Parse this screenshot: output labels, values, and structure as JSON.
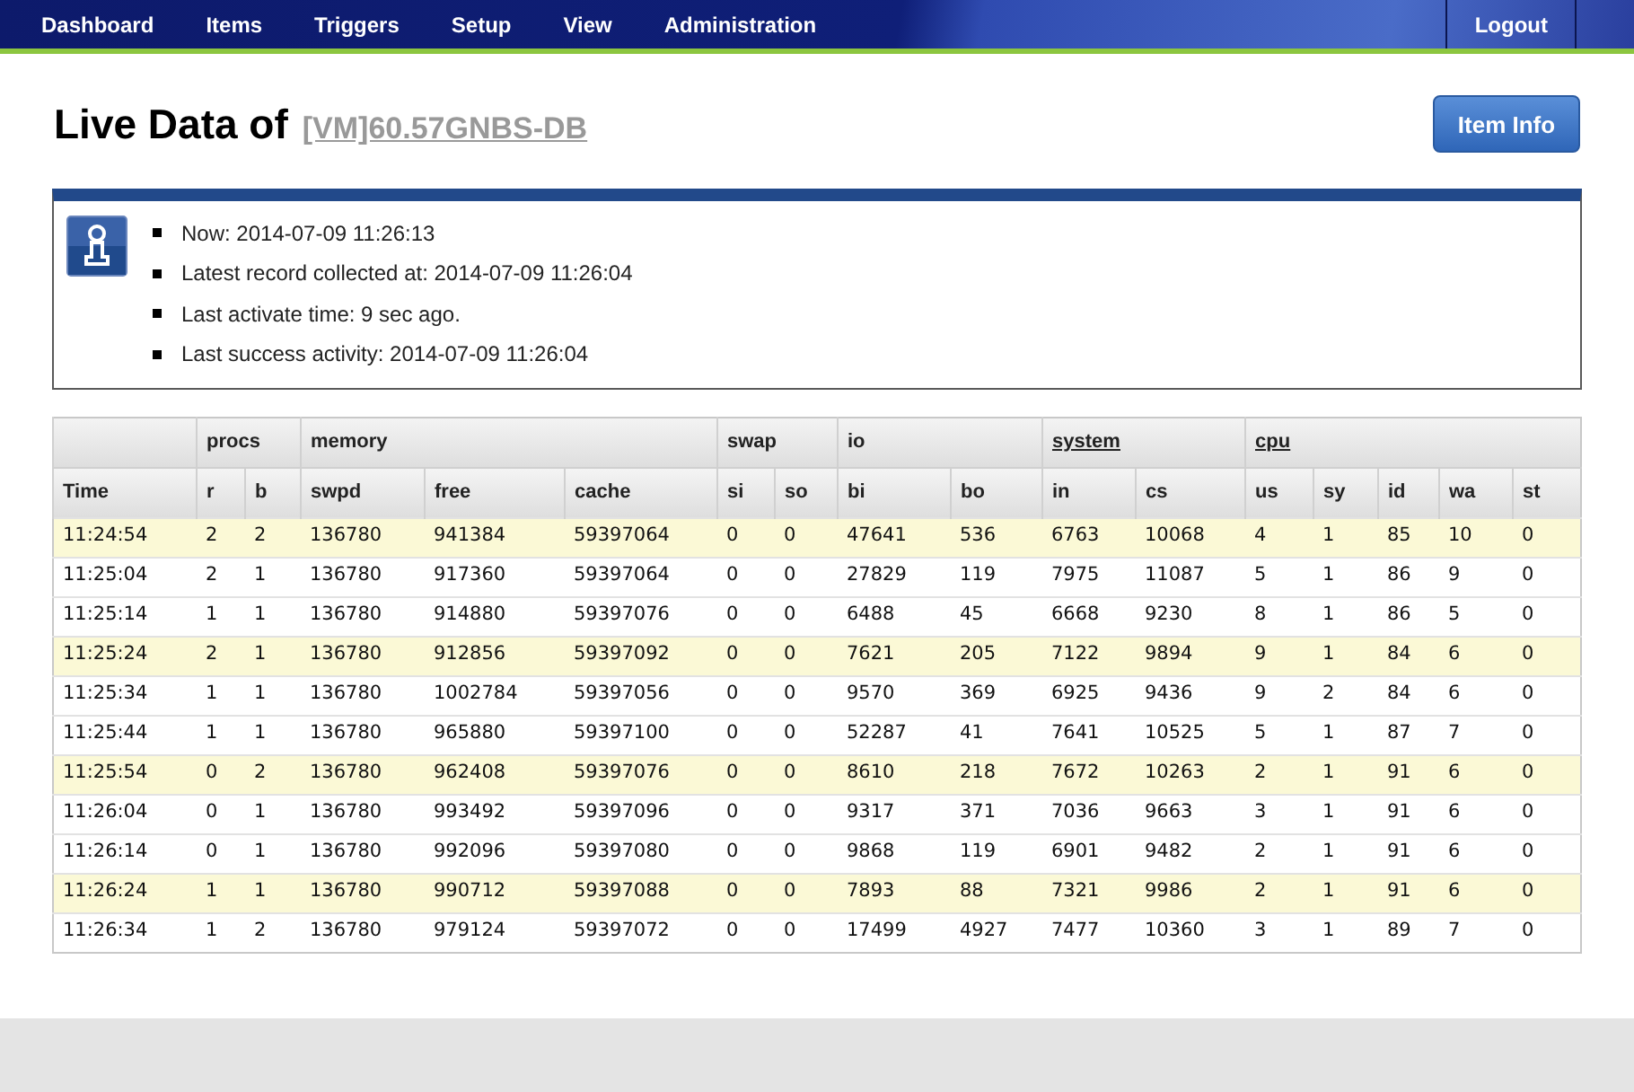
{
  "nav": {
    "items": [
      {
        "label": "Dashboard"
      },
      {
        "label": "Items"
      },
      {
        "label": "Triggers"
      },
      {
        "label": "Setup"
      },
      {
        "label": "View"
      },
      {
        "label": "Administration"
      }
    ],
    "logout": "Logout"
  },
  "header": {
    "title": "Live Data of",
    "host": "[VM]60.57GNBS-DB",
    "button": "Item Info"
  },
  "info": [
    "Now: 2014-07-09 11:26:13",
    "Latest record collected at: 2014-07-09 11:26:04",
    "Last activate time: 9 sec ago.",
    "Last success activity: 2014-07-09 11:26:04"
  ],
  "table": {
    "groups": [
      {
        "columns": [
          "Time"
        ]
      },
      {
        "label": "procs",
        "link": false,
        "columns": [
          "r",
          "b"
        ]
      },
      {
        "label": "memory",
        "link": false,
        "columns": [
          "swpd",
          "free",
          "cache"
        ]
      },
      {
        "label": "swap",
        "link": false,
        "columns": [
          "si",
          "so"
        ]
      },
      {
        "label": "io",
        "link": false,
        "columns": [
          "bi",
          "bo"
        ]
      },
      {
        "label": "system",
        "link": true,
        "columns": [
          "in",
          "cs"
        ]
      },
      {
        "label": "cpu",
        "link": true,
        "columns": [
          "us",
          "sy",
          "id",
          "wa",
          "st"
        ]
      }
    ],
    "rows": [
      {
        "highlighted": true,
        "cells": [
          "11:24:54",
          "2",
          "2",
          "136780",
          "941384",
          "59397064",
          "0",
          "0",
          "47641",
          "536",
          "6763",
          "10068",
          "4",
          "1",
          "85",
          "10",
          "0"
        ]
      },
      {
        "highlighted": false,
        "cells": [
          "11:25:04",
          "2",
          "1",
          "136780",
          "917360",
          "59397064",
          "0",
          "0",
          "27829",
          "119",
          "7975",
          "11087",
          "5",
          "1",
          "86",
          "9",
          "0"
        ]
      },
      {
        "highlighted": false,
        "cells": [
          "11:25:14",
          "1",
          "1",
          "136780",
          "914880",
          "59397076",
          "0",
          "0",
          "6488",
          "45",
          "6668",
          "9230",
          "8",
          "1",
          "86",
          "5",
          "0"
        ]
      },
      {
        "highlighted": true,
        "cells": [
          "11:25:24",
          "2",
          "1",
          "136780",
          "912856",
          "59397092",
          "0",
          "0",
          "7621",
          "205",
          "7122",
          "9894",
          "9",
          "1",
          "84",
          "6",
          "0"
        ]
      },
      {
        "highlighted": false,
        "cells": [
          "11:25:34",
          "1",
          "1",
          "136780",
          "1002784",
          "59397056",
          "0",
          "0",
          "9570",
          "369",
          "6925",
          "9436",
          "9",
          "2",
          "84",
          "6",
          "0"
        ]
      },
      {
        "highlighted": false,
        "cells": [
          "11:25:44",
          "1",
          "1",
          "136780",
          "965880",
          "59397100",
          "0",
          "0",
          "52287",
          "41",
          "7641",
          "10525",
          "5",
          "1",
          "87",
          "7",
          "0"
        ]
      },
      {
        "highlighted": true,
        "cells": [
          "11:25:54",
          "0",
          "2",
          "136780",
          "962408",
          "59397076",
          "0",
          "0",
          "8610",
          "218",
          "7672",
          "10263",
          "2",
          "1",
          "91",
          "6",
          "0"
        ]
      },
      {
        "highlighted": false,
        "cells": [
          "11:26:04",
          "0",
          "1",
          "136780",
          "993492",
          "59397096",
          "0",
          "0",
          "9317",
          "371",
          "7036",
          "9663",
          "3",
          "1",
          "91",
          "6",
          "0"
        ]
      },
      {
        "highlighted": false,
        "cells": [
          "11:26:14",
          "0",
          "1",
          "136780",
          "992096",
          "59397080",
          "0",
          "0",
          "9868",
          "119",
          "6901",
          "9482",
          "2",
          "1",
          "91",
          "6",
          "0"
        ]
      },
      {
        "highlighted": true,
        "cells": [
          "11:26:24",
          "1",
          "1",
          "136780",
          "990712",
          "59397088",
          "0",
          "0",
          "7893",
          "88",
          "7321",
          "9986",
          "2",
          "1",
          "91",
          "6",
          "0"
        ]
      },
      {
        "highlighted": false,
        "cells": [
          "11:26:34",
          "1",
          "2",
          "136780",
          "979124",
          "59397072",
          "0",
          "0",
          "17499",
          "4927",
          "7477",
          "10360",
          "3",
          "1",
          "89",
          "7",
          "0"
        ]
      }
    ]
  }
}
